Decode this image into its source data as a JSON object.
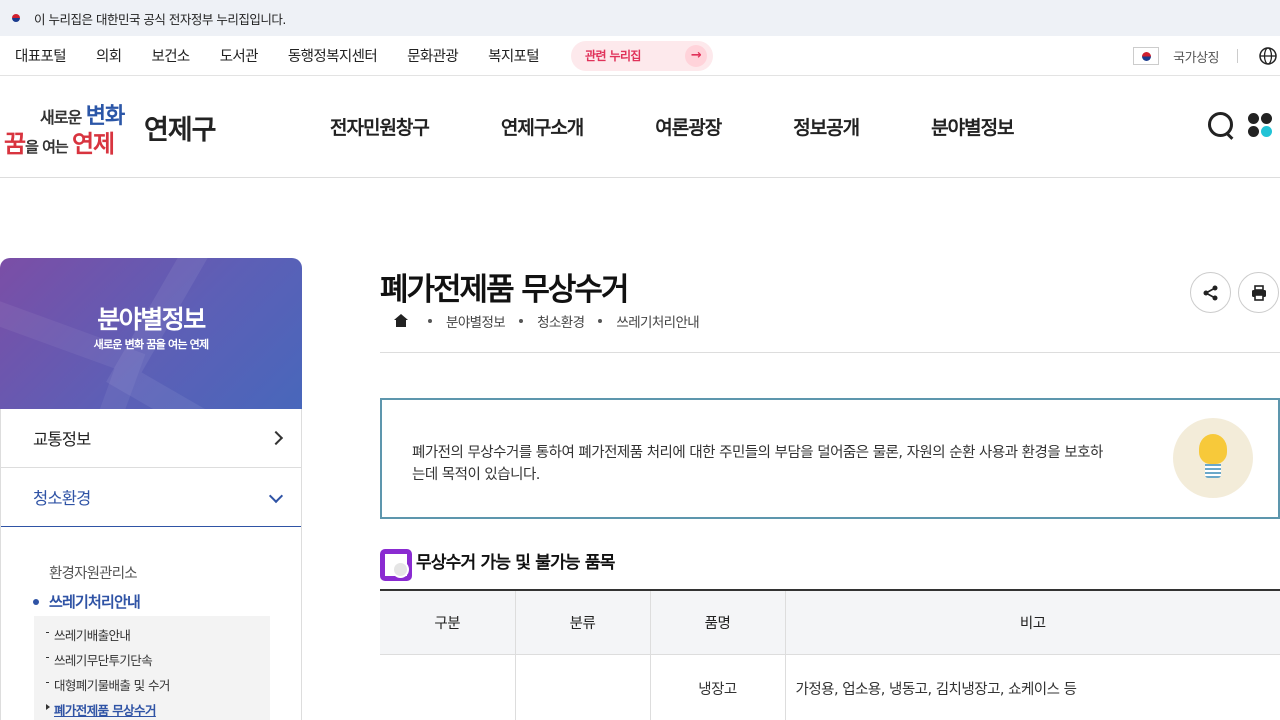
{
  "gov_banner": {
    "text": "이 누리집은 대한민국 공식 전자정부 누리집입니다."
  },
  "toplinks": [
    "대표포털",
    "의회",
    "보건소",
    "도서관",
    "동행정복지센터",
    "문화관광",
    "복지포털"
  ],
  "related_sites": {
    "label": "관련 누리집"
  },
  "national_symbol": {
    "label": "국가상징"
  },
  "logo": {
    "slogan_line1_a": "새로운 ",
    "slogan_line1_b": "변화",
    "slogan_line2_a": "꿈",
    "slogan_line2_b": "을 여는 ",
    "slogan_line2_c": "연제",
    "name": "연제구"
  },
  "gnb": [
    "전자민원창구",
    "연제구소개",
    "여론광장",
    "정보공개",
    "분야별정보"
  ],
  "sidebar": {
    "title": "분야별정보",
    "subtitle": "새로운 변화 꿈을 여는 연제",
    "items": [
      {
        "label": "교통정보"
      },
      {
        "label": "청소환경"
      }
    ],
    "sub2_a": "환경자원관리소",
    "sub2_b": "쓰레기처리안내",
    "sub3": [
      "쓰레기배출안내",
      "쓰레기무단투기단속",
      "대형폐기물배출 및 수거",
      "폐가전제품 무상수거"
    ]
  },
  "page": {
    "title": "폐가전제품 무상수거",
    "breadcrumb": [
      "분야별정보",
      "청소환경",
      "쓰레기처리안내"
    ]
  },
  "info": {
    "text": "폐가전의 무상수거를 통하여 폐가전제품 처리에 대한 주민들의 부담을 덜어줌은 물론, 자원의 순환 사용과 환경을 보호하는데 목적이 있습니다."
  },
  "section": {
    "title": "무상수거 가능 및 불가능 품목"
  },
  "table": {
    "headers": [
      "구분",
      "분류",
      "품명",
      "비고"
    ],
    "rows": [
      {
        "c1": "",
        "c2": "",
        "c3": "냉장고",
        "c4": "가정용, 업소용, 냉동고, 김치냉장고, 쇼케이스 등"
      }
    ]
  }
}
